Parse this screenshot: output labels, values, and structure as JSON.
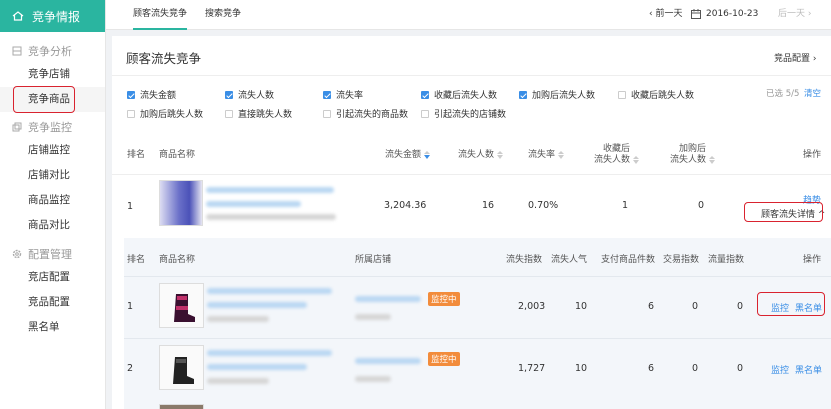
{
  "brand": {
    "title": "竞争情报"
  },
  "sidebar": {
    "groups": [
      {
        "title": "竞争分析",
        "items": [
          "竞争店铺",
          "竞争商品"
        ]
      },
      {
        "title": "竞争监控",
        "items": [
          "店铺监控",
          "店铺对比",
          "商品监控",
          "商品对比"
        ]
      },
      {
        "title": "配置管理",
        "items": [
          "竞店配置",
          "竞品配置",
          "黑名单"
        ]
      }
    ]
  },
  "topbar": {
    "tabs": [
      "顾客流失竞争",
      "搜索竞争"
    ],
    "prev": "‹ 前一天",
    "date": "2016-10-23",
    "next": "后一天 ›"
  },
  "main": {
    "title": "顾客流失竞争",
    "config": "竞品配置 ›",
    "filters": [
      {
        "label": "流失金额",
        "checked": true
      },
      {
        "label": "流失人数",
        "checked": true
      },
      {
        "label": "流失率",
        "checked": true
      },
      {
        "label": "收藏后流失人数",
        "checked": true
      },
      {
        "label": "加购后流失人数",
        "checked": true
      },
      {
        "label": "收藏后跳失人数",
        "checked": false
      },
      {
        "label": "加购后跳失人数",
        "checked": false
      },
      {
        "label": "直接跳失人数",
        "checked": false
      },
      {
        "label": "引起流失的商品数",
        "checked": false
      },
      {
        "label": "引起流失的店铺数",
        "checked": false
      }
    ],
    "selected_count": "已选 5/5",
    "clear": "清空"
  },
  "table": {
    "headers": {
      "rank": "排名",
      "name": "商品名称",
      "amount": "流失金额",
      "people": "流失人数",
      "rate": "流失率",
      "fav1": "收藏后",
      "fav2": "流失人数",
      "cart1": "加购后",
      "cart2": "流失人数",
      "op": "操作"
    },
    "row": {
      "rank": "1",
      "amount": "3,204.36",
      "people": "16",
      "rate": "0.70%",
      "fav": "1",
      "cart": "0",
      "trend": "趋势",
      "detail": "顾客流失详情 ^"
    }
  },
  "subtable": {
    "headers": {
      "rank": "排名",
      "name": "商品名称",
      "shop": "所属店铺",
      "index": "流失指数",
      "pop": "流失人气",
      "pay": "支付商品件数",
      "trade": "交易指数",
      "flow": "流量指数",
      "op": "操作"
    },
    "rows": [
      {
        "rank": "1",
        "badge": "监控中",
        "index": "2,003",
        "pop": "10",
        "pay": "6",
        "trade": "0",
        "flow": "0",
        "monitor": "监控",
        "blacklist": "黑名单"
      },
      {
        "rank": "2",
        "badge": "监控中",
        "index": "1,727",
        "pop": "10",
        "pay": "6",
        "trade": "0",
        "flow": "0",
        "monitor": "监控",
        "blacklist": "黑名单"
      }
    ]
  }
}
